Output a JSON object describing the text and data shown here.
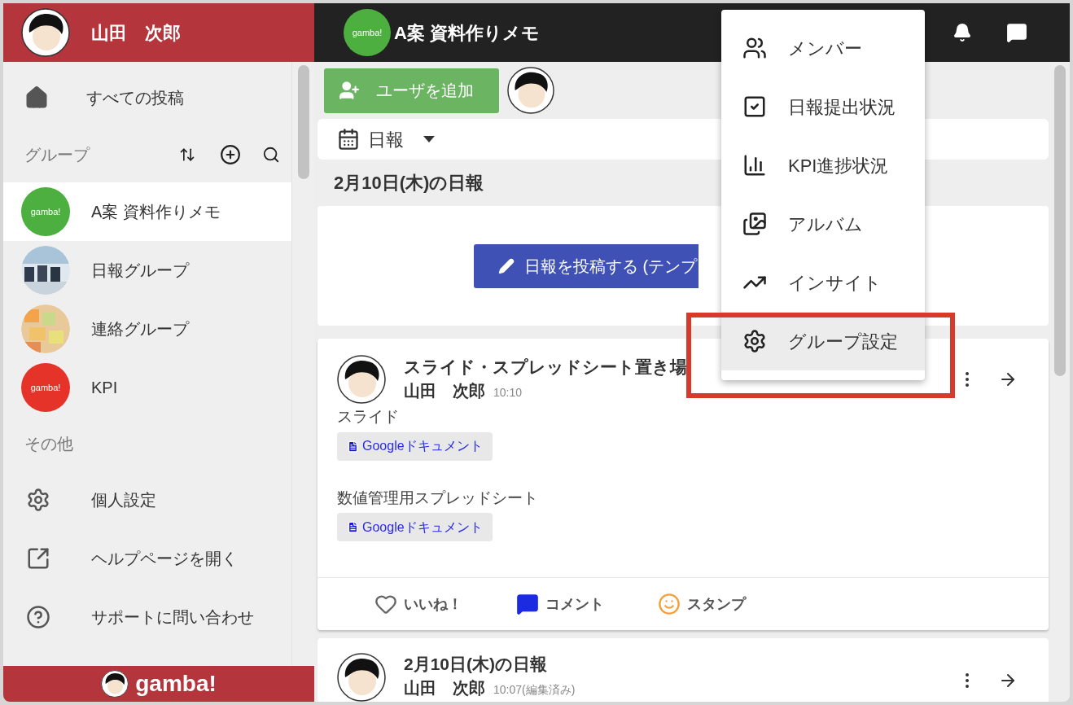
{
  "sidebar": {
    "user_name": "山田　次郎",
    "nav": [
      {
        "label": "すべての投稿",
        "kind": "home",
        "selected": false
      }
    ],
    "groups_heading": "グループ",
    "groups": [
      {
        "name": "A案 資料作りメモ",
        "kind": "logo",
        "logo_text": "gamba!",
        "color": "#4caf3f",
        "selected": true
      },
      {
        "name": "日報グループ",
        "kind": "picture",
        "selected": false
      },
      {
        "name": "連絡グループ",
        "kind": "picture",
        "selected": false
      },
      {
        "name": "KPI",
        "kind": "logo",
        "logo_text": "gamba!",
        "color": "#e5332a",
        "selected": false
      }
    ],
    "other_heading": "その他",
    "other_items": [
      {
        "label": "個人設定",
        "kind": "settings"
      },
      {
        "label": "ヘルプページを開く",
        "kind": "external"
      },
      {
        "label": "サポートに問い合わせ",
        "kind": "help"
      }
    ],
    "footer_logo": "gamba!"
  },
  "header": {
    "logo_text": "gamba!",
    "title": "A案 資料作りメモ"
  },
  "toolbar": {
    "add_user_button": "ユーザを追加",
    "filter": "日報"
  },
  "date_heading": "2月10日(木)の日報",
  "post_button": "日報を投稿する (テンプ",
  "posts": [
    {
      "title": "スライド・スプレッドシート置き場",
      "author": "山田　次郎",
      "time": "10:10",
      "sections": [
        {
          "label": "スライド",
          "attachment": "Googleドキュメント"
        },
        {
          "label": "数値管理用スプレッドシート",
          "attachment": "Googleドキュメント"
        }
      ],
      "actions": [
        {
          "label": "いいね！",
          "kind": "like"
        },
        {
          "label": "コメント",
          "kind": "comment"
        },
        {
          "label": "スタンプ",
          "kind": "stamp"
        }
      ]
    },
    {
      "title": "2月10日(木)の日報",
      "author": "山田　次郎",
      "time": "10:07(編集済み)"
    }
  ],
  "menu": {
    "items": [
      {
        "label": "メンバー",
        "kind": "members",
        "selected": false
      },
      {
        "label": "日報提出状況",
        "kind": "check",
        "selected": false
      },
      {
        "label": "KPI進捗状況",
        "kind": "chart",
        "selected": false
      },
      {
        "label": "アルバム",
        "kind": "album",
        "selected": false
      },
      {
        "label": "インサイト",
        "kind": "insight",
        "selected": false
      },
      {
        "label": "グループ設定",
        "kind": "settings",
        "selected": true
      }
    ]
  }
}
